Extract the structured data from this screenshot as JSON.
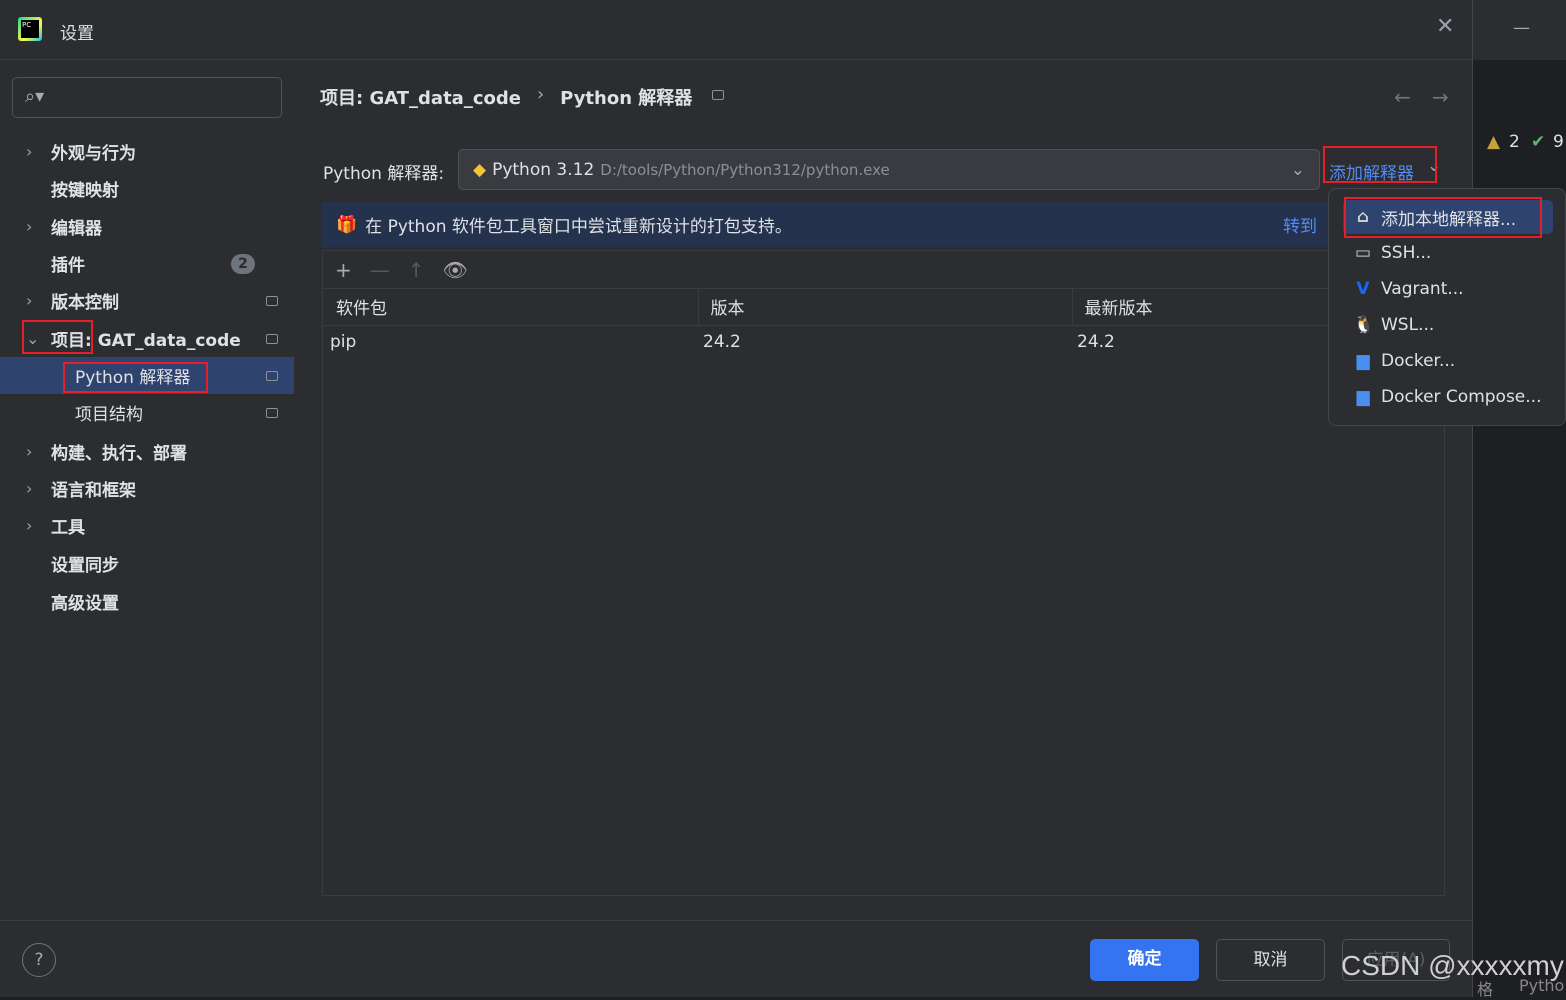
{
  "window": {
    "title": "设置"
  },
  "search": {
    "placeholder": ""
  },
  "breadcrumb": {
    "project": "项目: GAT_data_code",
    "sep": "›",
    "page": "Python 解释器"
  },
  "sidebar": {
    "items": [
      {
        "label": "外观与行为",
        "expandable": true
      },
      {
        "label": "按键映射"
      },
      {
        "label": "编辑器",
        "expandable": true
      },
      {
        "label": "插件",
        "badge": "2"
      },
      {
        "label": "版本控制",
        "expandable": true
      },
      {
        "label": "项目: GAT_data_code",
        "expanded": true
      },
      {
        "label": "Python 解释器",
        "selected": true
      },
      {
        "label": "项目结构"
      },
      {
        "label": "构建、执行、部署",
        "expandable": true
      },
      {
        "label": "语言和框架",
        "expandable": true
      },
      {
        "label": "工具",
        "expandable": true
      },
      {
        "label": "设置同步"
      },
      {
        "label": "高级设置"
      }
    ]
  },
  "interpreter": {
    "label": "Python 解释器:",
    "name": "Python 3.12",
    "path": "D:/tools/Python/Python312/python.exe",
    "add_label": "添加解释器"
  },
  "banner": {
    "text": "在 Python 软件包工具窗口中尝试重新设计的打包支持。",
    "link": "转到"
  },
  "toolbar": {
    "add": "+",
    "remove": "—",
    "upgrade": "↑",
    "show": "eye-icon"
  },
  "table": {
    "headers": [
      "软件包",
      "版本",
      "最新版本"
    ],
    "rows": [
      [
        "pip",
        "24.2",
        "24.2"
      ]
    ]
  },
  "menu": {
    "items": [
      {
        "label": "添加本地解释器...",
        "icon": "home-icon"
      },
      {
        "label": "SSH...",
        "icon": "terminal-icon"
      },
      {
        "label": "Vagrant...",
        "icon": "vagrant-icon"
      },
      {
        "label": "WSL...",
        "icon": "linux-icon"
      },
      {
        "label": "Docker...",
        "icon": "docker-icon"
      },
      {
        "label": "Docker Compose...",
        "icon": "docker-compose-icon"
      }
    ]
  },
  "footer": {
    "ok": "确定",
    "cancel": "取消",
    "apply": "应用(A)",
    "help": "?"
  },
  "background": {
    "warnings": "2",
    "checks": "9",
    "status1": "格",
    "status2": "Pytho"
  },
  "watermark": "CSDN @xxxxxmy",
  "colors": {
    "accent": "#3574f0",
    "link": "#548af7",
    "selected": "#2e436e",
    "highlight": "#e5202b"
  }
}
